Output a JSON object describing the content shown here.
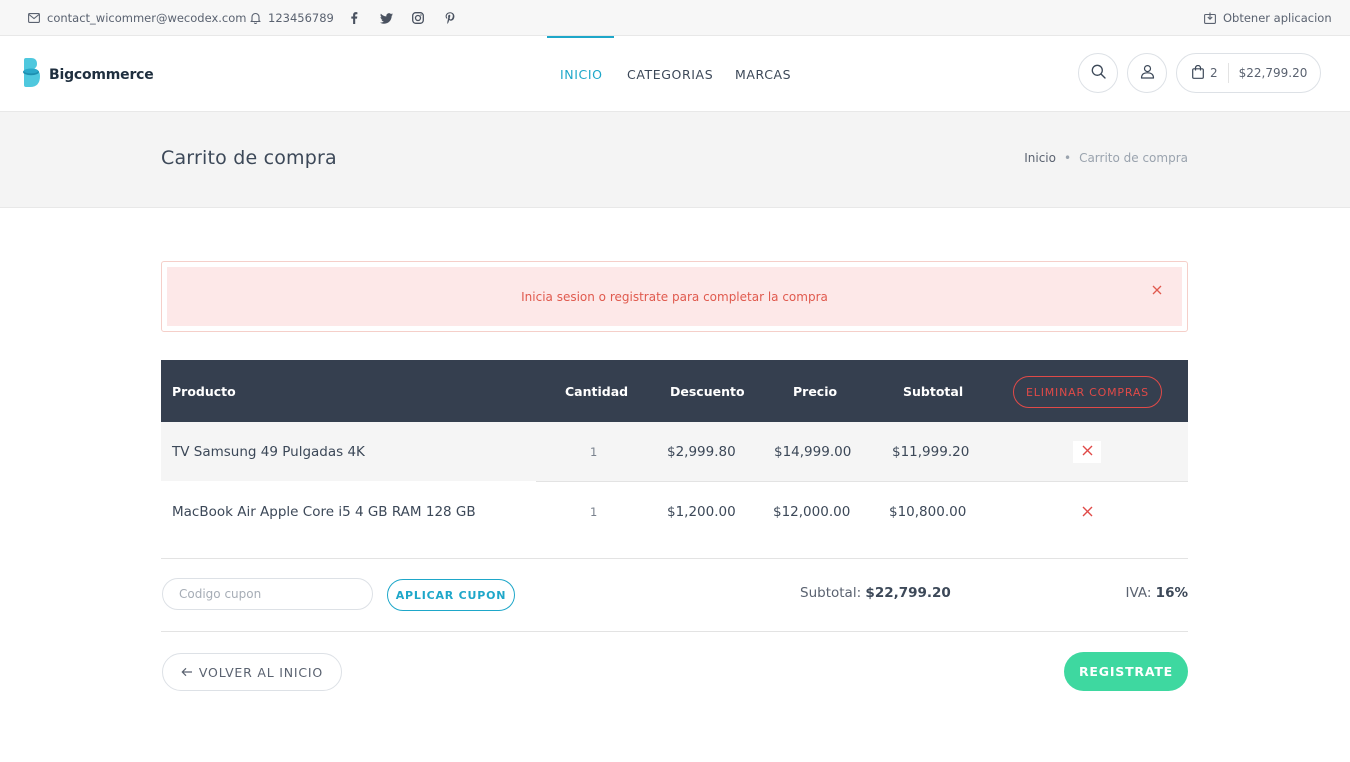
{
  "topbar": {
    "email": "contact_wicommer@wecodex.com",
    "phone": "123456789",
    "social_icons": [
      "facebook-icon",
      "twitter-icon",
      "instagram-icon",
      "pinterest-icon"
    ],
    "app_link": "Obtener aplicacion"
  },
  "header": {
    "logo_text": "Bigcommerce",
    "nav": [
      {
        "label": "INICIO",
        "active": true
      },
      {
        "label": "CATEGORIAS",
        "active": false
      },
      {
        "label": "MARCAS",
        "active": false
      }
    ],
    "cart_count": "2",
    "cart_total": "$22,799.20"
  },
  "banner": {
    "title": "Carrito de compra",
    "breadcrumb": [
      "Inicio",
      "Carrito de compra"
    ]
  },
  "alert": {
    "message": "Inicia sesion o registrate para completar la compra"
  },
  "table": {
    "headers": {
      "product": "Producto",
      "quantity": "Cantidad",
      "discount": "Descuento",
      "price": "Precio",
      "subtotal": "Subtotal",
      "clear_button": "ELIMINAR COMPRAS"
    },
    "rows": [
      {
        "product": "TV Samsung 49 Pulgadas 4K",
        "quantity": "1",
        "discount": "$2,999.80",
        "price": "$14,999.00",
        "subtotal": "$11,999.20"
      },
      {
        "product": "MacBook Air Apple Core i5 4 GB RAM 128 GB",
        "quantity": "1",
        "discount": "$1,200.00",
        "price": "$12,000.00",
        "subtotal": "$10,800.00"
      }
    ]
  },
  "coupon": {
    "placeholder": "Codigo cupon",
    "value": "",
    "button": "APLICAR CUPON"
  },
  "totals": {
    "subtotal_label": "Subtotal:",
    "subtotal_value": "$22,799.20",
    "iva_label": "IVA:",
    "iva_value": "16%"
  },
  "actions": {
    "back": "VOLVER AL INICIO",
    "register": "REGISTRATE"
  },
  "colors": {
    "accent": "#1ea7c9",
    "danger": "#e04a48",
    "success": "#3ed8a0",
    "table_header": "#353f4f",
    "alert_bg": "#fde8e8"
  }
}
